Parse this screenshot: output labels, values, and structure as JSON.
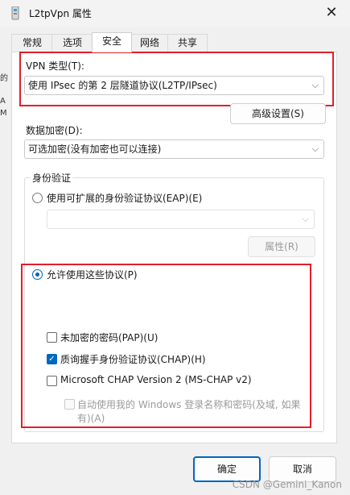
{
  "window": {
    "title": "L2tpVpn 属性",
    "close_glyph": "✕"
  },
  "tabs": [
    "常规",
    "选项",
    "安全",
    "网络",
    "共享"
  ],
  "left_edge_fragments": [
    "的",
    "A",
    "M"
  ],
  "vpn_type": {
    "label": "VPN 类型(T):",
    "value": "使用 IPsec 的第 2 层隧道协议(L2TP/IPsec)"
  },
  "advanced_button": "高级设置(S)",
  "data_encryption": {
    "label": "数据加密(D):",
    "value": "可选加密(没有加密也可以连接)"
  },
  "authentication": {
    "group_label": "身份验证",
    "eap_radio": "使用可扩展的身份验证协议(EAP)(E)",
    "eap_dropdown_value": "",
    "properties_button": "属性(R)",
    "allow_radio": "允许使用这些协议(P)",
    "protocols": [
      {
        "label": "未加密的密码(PAP)(U)",
        "checked": false,
        "enabled": true
      },
      {
        "label": "质询握手身份验证协议(CHAP)(H)",
        "checked": true,
        "enabled": true
      },
      {
        "label": "Microsoft CHAP Version 2 (MS-CHAP v2)",
        "checked": false,
        "enabled": true
      }
    ],
    "auto_windows_line1": "自动使用我的 Windows 登录名称和密码(及域, 如果",
    "auto_windows_line2": "有)(A)"
  },
  "footer": {
    "ok": "确定",
    "cancel": "取消",
    "watermark": "CSDN @Gemini_Kanon"
  },
  "colors": {
    "accent": "#0067c0",
    "highlight_border": "#e0202a"
  }
}
